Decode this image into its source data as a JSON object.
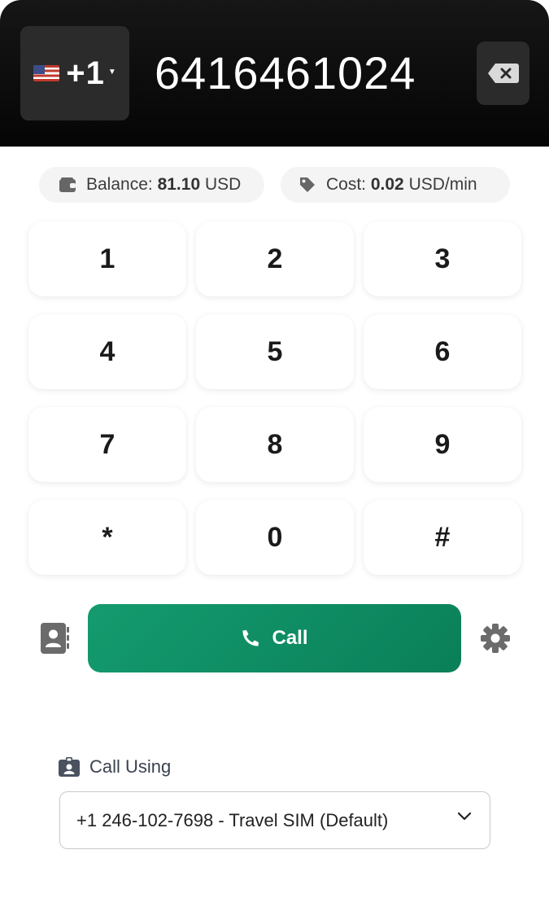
{
  "header": {
    "country_code": "+1",
    "country_flag": "us-flag-icon",
    "phone_number": "6416461024"
  },
  "info": {
    "balance_label": "Balance:",
    "balance_value": "81.10",
    "balance_unit": "USD",
    "cost_label": "Cost:",
    "cost_value": "0.02",
    "cost_unit": "USD/min"
  },
  "keypad": [
    "1",
    "2",
    "3",
    "4",
    "5",
    "6",
    "7",
    "8",
    "9",
    "*",
    "0",
    "#"
  ],
  "call_label": "Call",
  "call_using": {
    "label": "Call Using",
    "selected": "+1 246-102-7698 - Travel SIM (Default)"
  },
  "colors": {
    "accent": "#0f8c63",
    "header_bg": "#0a0a0a",
    "icon_gray": "#6b6b6b"
  }
}
